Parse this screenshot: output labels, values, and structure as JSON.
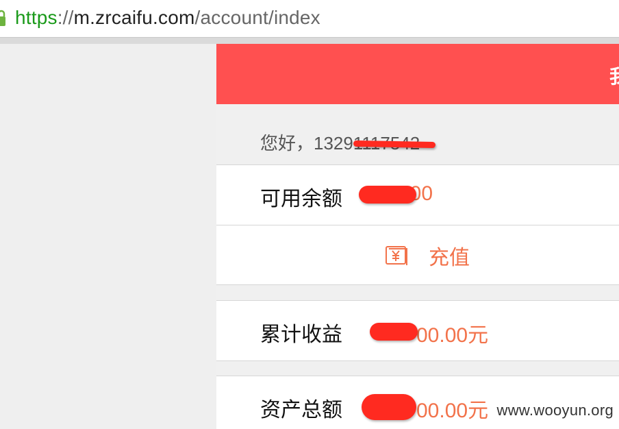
{
  "browser": {
    "url_scheme": "https",
    "url_sep": "://",
    "url_host": "m.zrcaifu.com",
    "url_path": "/account/index"
  },
  "header": {
    "title_fragment": "我"
  },
  "greeting": {
    "prefix": "您好，",
    "phone_visible": "13291117542"
  },
  "balance": {
    "label": "可用余额",
    "value_visible": "200"
  },
  "recharge": {
    "icon": "yen-icon",
    "label": "充值"
  },
  "earnings": {
    "label": "累计收益",
    "value_visible": "00.00元"
  },
  "assets": {
    "label": "资产总额",
    "value_visible": "00.00元"
  },
  "watermark": "www.wooyun.org",
  "colors": {
    "header": "#ff5050",
    "accent": "#f2724a",
    "redaction": "#ff2a20"
  }
}
